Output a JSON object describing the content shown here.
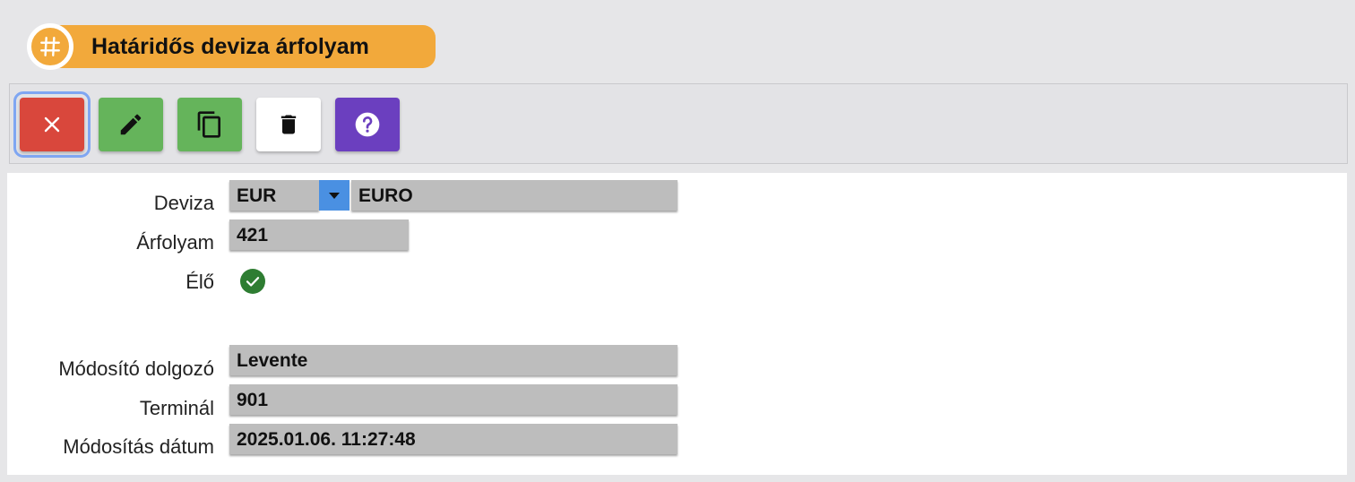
{
  "header": {
    "icon": "hashtag-icon",
    "title": "Határidős deviza árfolyam",
    "accent_color": "#f2a93b"
  },
  "toolbar": {
    "buttons": [
      {
        "name": "close",
        "icon": "close-icon",
        "color": "#d9473c"
      },
      {
        "name": "edit",
        "icon": "pencil-icon",
        "color": "#65b45b"
      },
      {
        "name": "copy",
        "icon": "copy-icon",
        "color": "#65b45b"
      },
      {
        "name": "delete",
        "icon": "trash-icon",
        "color": "#ffffff"
      },
      {
        "name": "help",
        "icon": "help-icon",
        "color": "#6b3fbf"
      }
    ]
  },
  "form": {
    "deviza": {
      "label": "Deviza",
      "code": "EUR",
      "name": "EURO"
    },
    "arfolyam": {
      "label": "Árfolyam",
      "value": "421"
    },
    "elo": {
      "label": "Élő",
      "checked": true
    },
    "modosito": {
      "label": "Módosító dolgozó",
      "value": "Levente"
    },
    "terminal": {
      "label": "Terminál",
      "value": "901"
    },
    "datum": {
      "label": "Módosítás dátum",
      "value": "2025.01.06. 11:27:48"
    }
  }
}
